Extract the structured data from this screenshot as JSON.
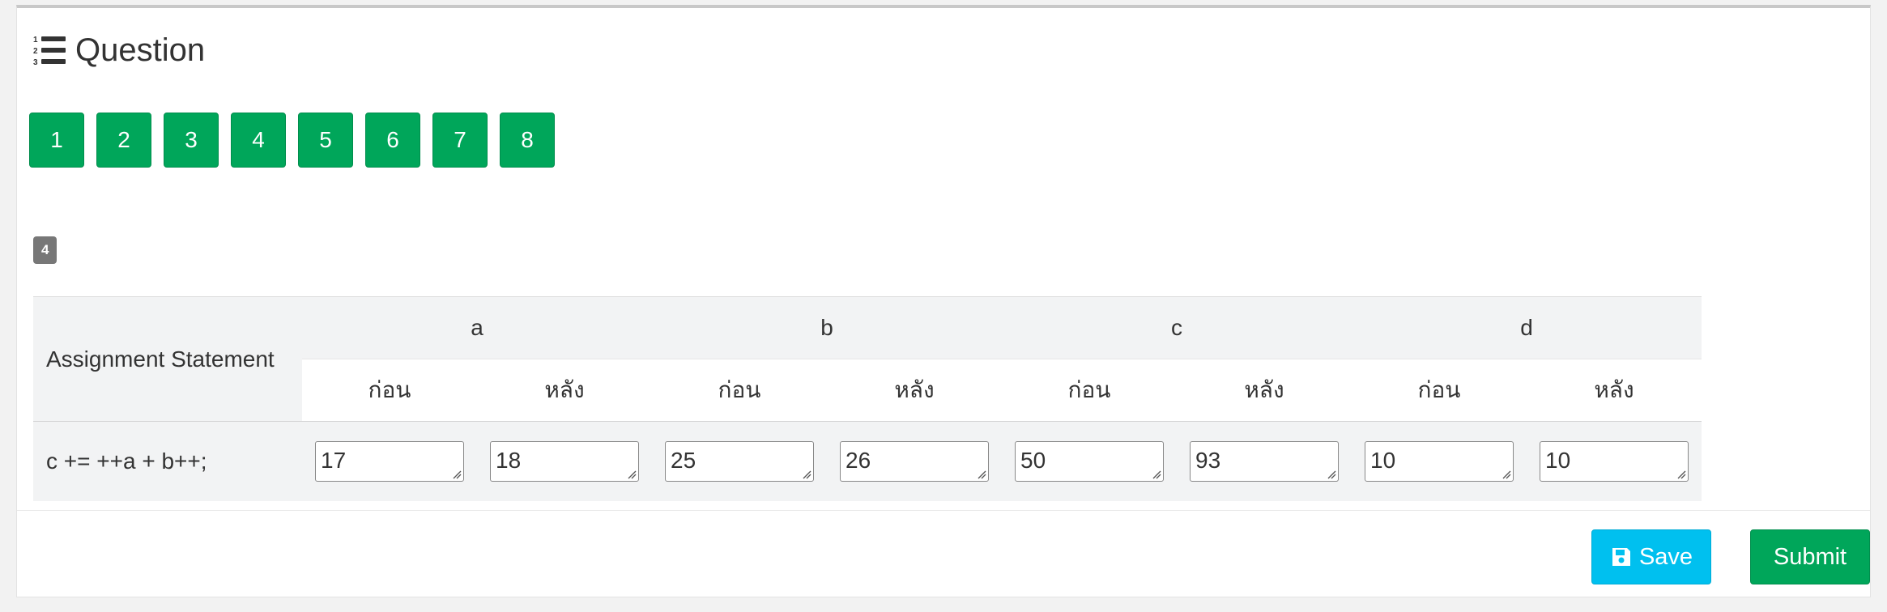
{
  "header": {
    "title": "Question",
    "icon": "list-ol-icon"
  },
  "question_nav": [
    "1",
    "2",
    "3",
    "4",
    "5",
    "6",
    "7",
    "8"
  ],
  "question_label": "4",
  "table": {
    "row_header": "Assignment Statement",
    "variables": [
      "a",
      "b",
      "c",
      "d"
    ],
    "before_label": "ก่อน",
    "after_label": "หลัง",
    "statement": "c += ++a + b++;",
    "values": {
      "a_before": "17",
      "a_after": "18",
      "b_before": "25",
      "b_after": "26",
      "c_before": "50",
      "c_after": "93",
      "d_before": "10",
      "d_after": "10"
    }
  },
  "actions": {
    "save_label": "Save",
    "submit_label": "Submit",
    "save_icon": "floppy-disk-icon"
  },
  "colors": {
    "green": "#00a65a",
    "cyan": "#00c0ef",
    "badge_gray": "#777777"
  }
}
